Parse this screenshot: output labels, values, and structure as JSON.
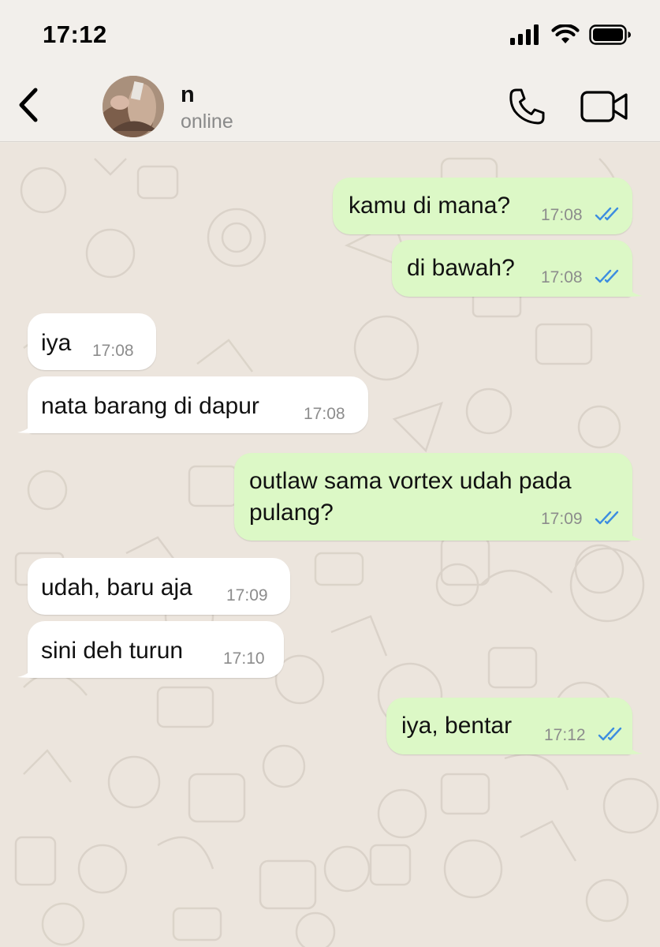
{
  "status_bar": {
    "time": "17:12",
    "icons": [
      "cellular-signal-icon",
      "wifi-icon",
      "battery-icon"
    ]
  },
  "header": {
    "back_icon": "chevron-left-icon",
    "contact_name": "n",
    "contact_status": "online",
    "actions": [
      "phone-icon",
      "video-camera-icon"
    ]
  },
  "colors": {
    "outgoing_bubble": "#dcf8c6",
    "incoming_bubble": "#ffffff",
    "read_ticks": "#3d8de0",
    "wallpaper": "#ece5dd"
  },
  "messages": [
    {
      "direction": "outgoing",
      "text": "kamu di mana?",
      "time": "17:08",
      "status": "read"
    },
    {
      "direction": "outgoing",
      "text": "di bawah?",
      "time": "17:08",
      "status": "read"
    },
    {
      "direction": "incoming",
      "text": "iya",
      "time": "17:08"
    },
    {
      "direction": "incoming",
      "text": "nata barang di dapur",
      "time": "17:08"
    },
    {
      "direction": "outgoing",
      "text": "outlaw sama vortex udah pada\npulang?",
      "time": "17:09",
      "status": "read"
    },
    {
      "direction": "incoming",
      "text": "udah, baru aja",
      "time": "17:09"
    },
    {
      "direction": "incoming",
      "text": "sini deh turun",
      "time": "17:10"
    },
    {
      "direction": "outgoing",
      "text": "iya, bentar",
      "time": "17:12",
      "status": "read"
    }
  ]
}
